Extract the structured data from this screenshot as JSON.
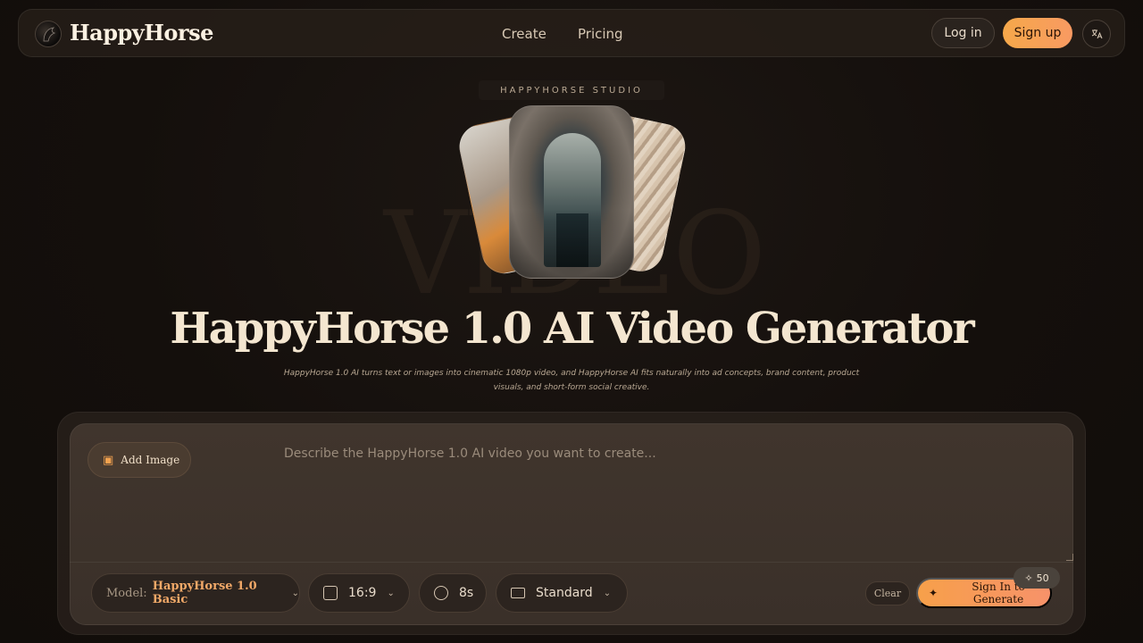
{
  "nav": {
    "brand": "HappyHorse",
    "links": [
      "Create",
      "Pricing"
    ],
    "login": "Log in",
    "signup": "Sign up"
  },
  "hero": {
    "eyebrow": "HAPPYHORSE STUDIO",
    "background_word": "VIDEO",
    "title": "HappyHorse 1.0 AI Video Generator",
    "subtitle": "HappyHorse 1.0 AI turns text or images into cinematic 1080p video, and HappyHorse AI fits naturally into ad concepts, brand content, product visuals, and short-form social creative."
  },
  "generator": {
    "add_image": "Add Image",
    "prompt_placeholder": "Describe the HappyHorse 1.0 AI video you want to create...",
    "model_label": "Model:",
    "model_value": "HappyHorse 1.0 Basic",
    "aspect_ratio": "16:9",
    "duration": "8s",
    "quality": "Standard",
    "clear": "Clear",
    "generate": "Sign In to Generate",
    "credits": "50"
  },
  "colors": {
    "accent": "#f6a84a",
    "background": "#140f0c"
  }
}
